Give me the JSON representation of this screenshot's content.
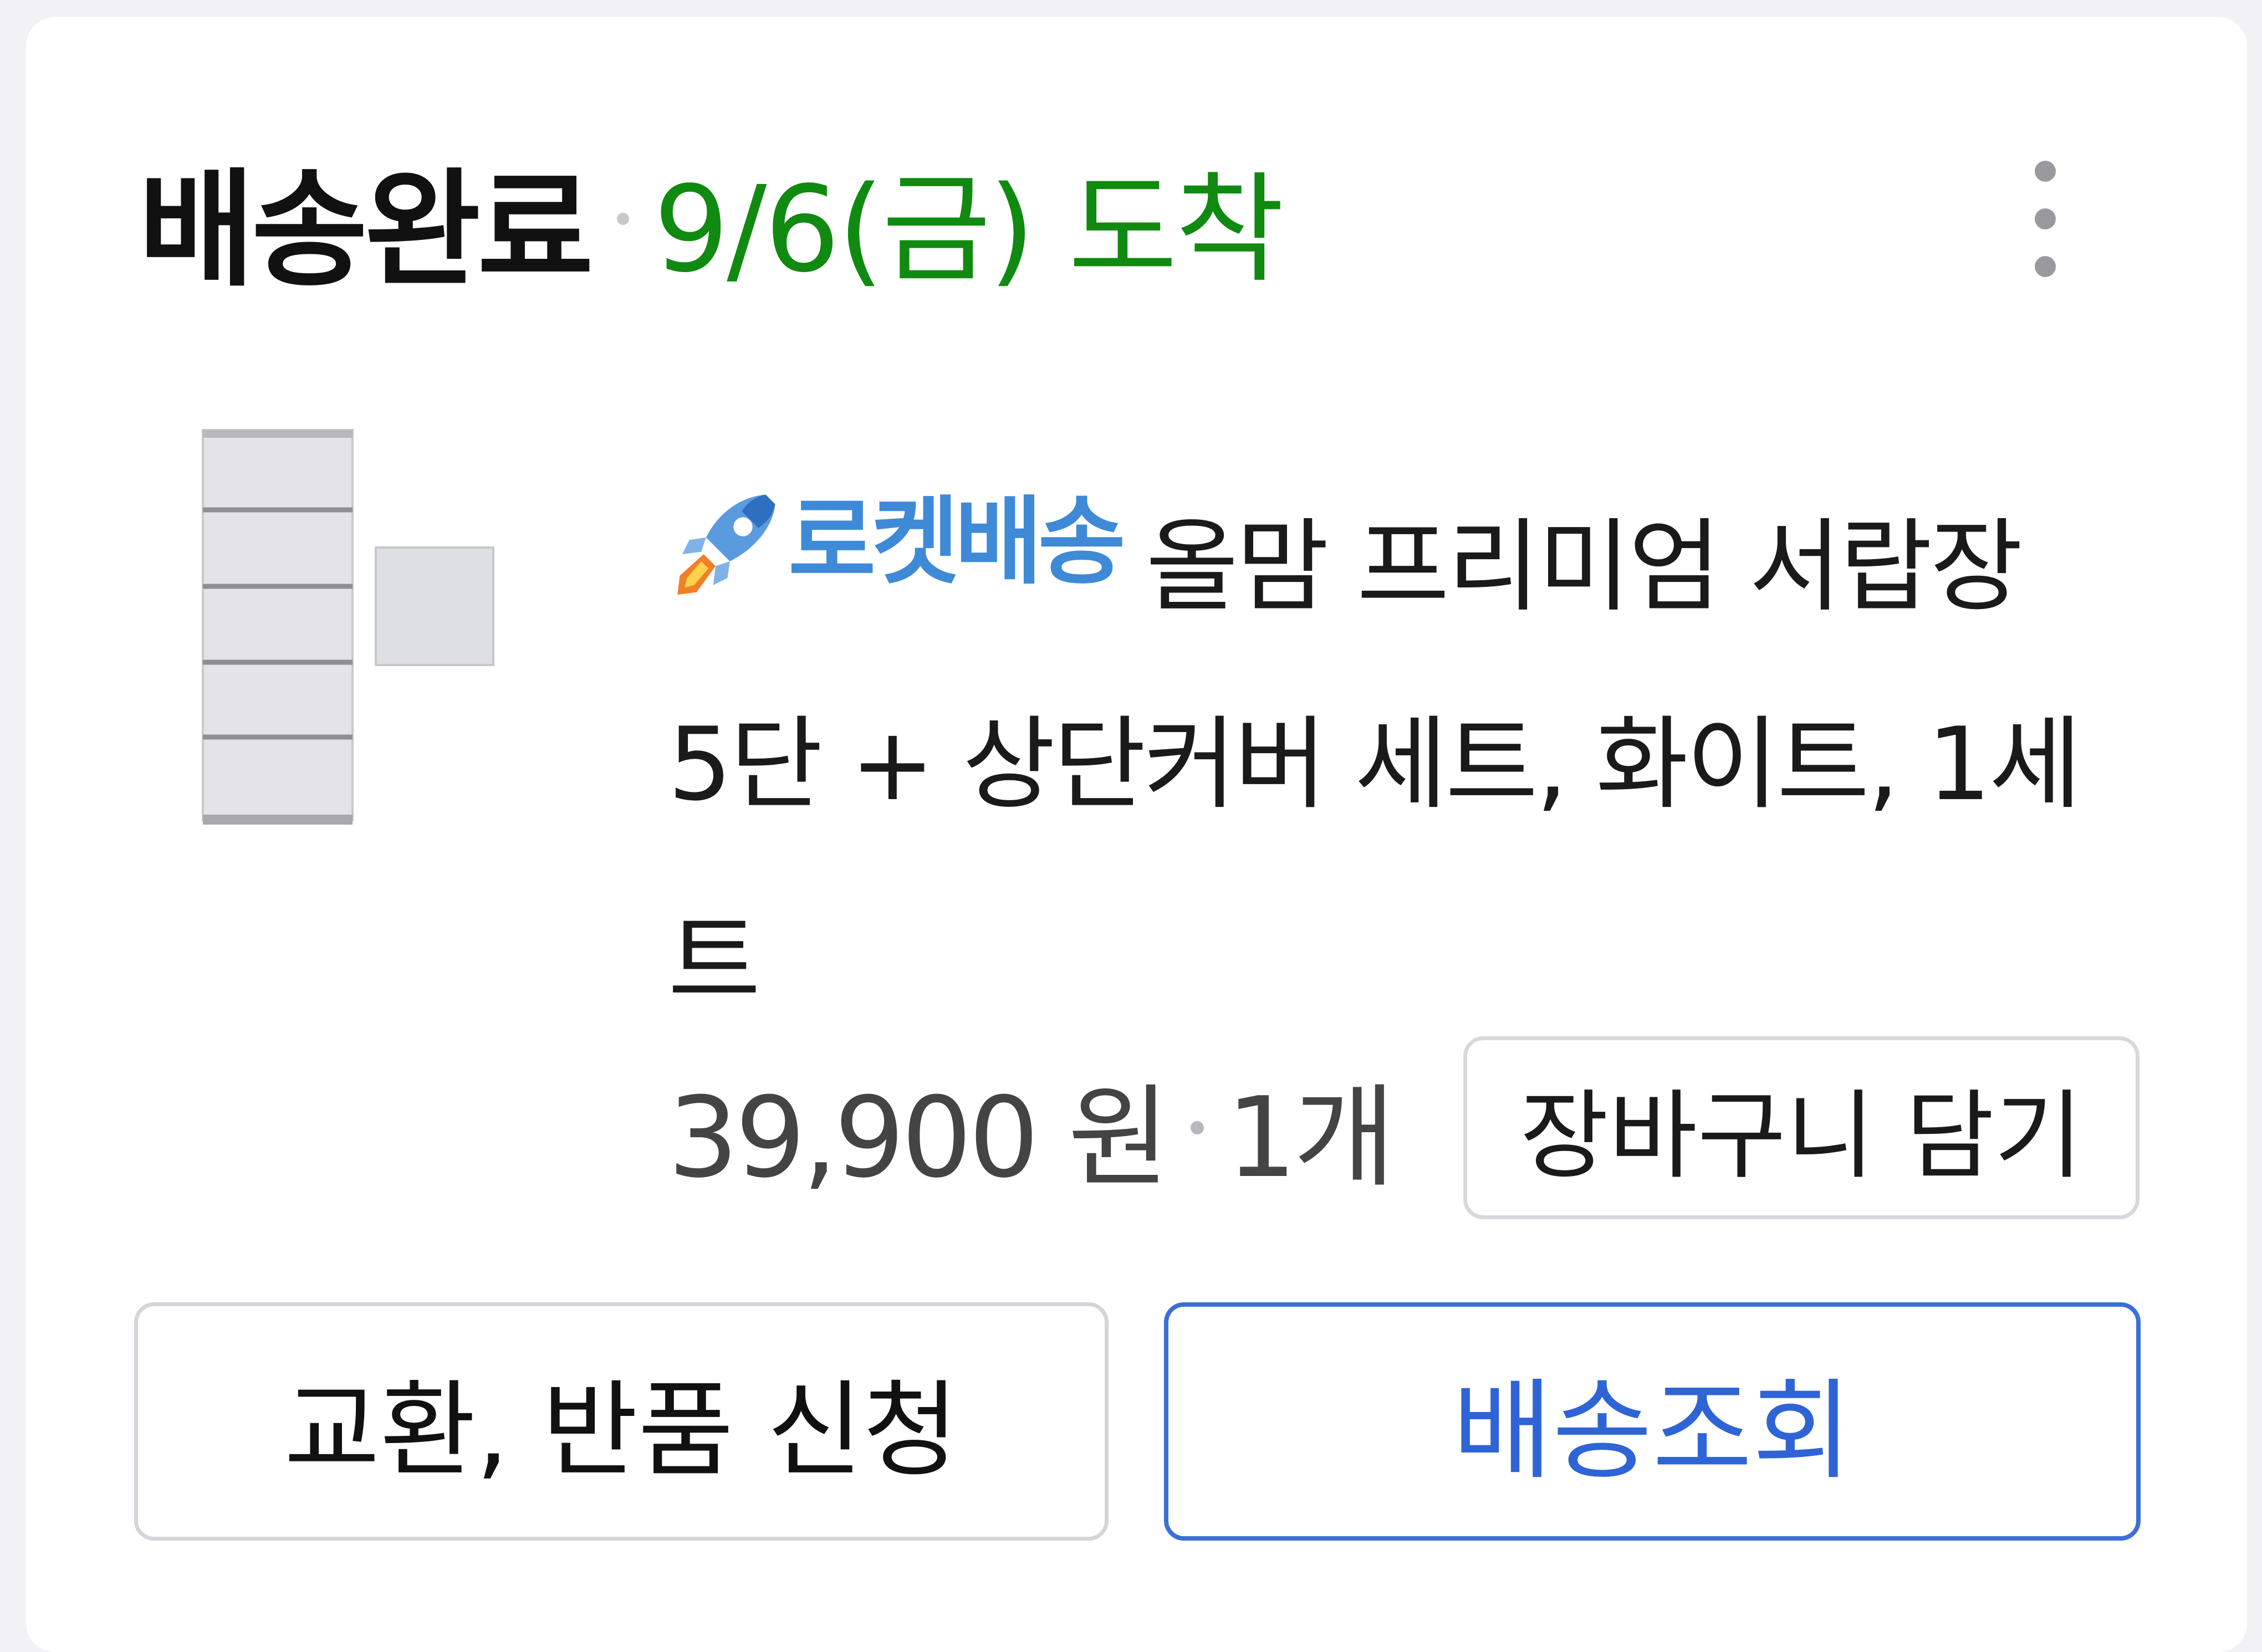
{
  "order": {
    "status": "배송완료",
    "arrival": "9/6(금) 도착"
  },
  "icons": {
    "more": "more-vertical-icon",
    "rocket": "rocket-icon"
  },
  "product": {
    "badge": "로켓배송",
    "title": "올맘 프리미엄 서랍장 5단 + 상단커버 세트, 화이트, 1세트",
    "price": "39,900 원",
    "quantity": "1개"
  },
  "actions": {
    "add_to_cart": "장바구니 담기",
    "return_exchange": "교환, 반품 신청",
    "track_delivery": "배송조회"
  },
  "colors": {
    "arrival": "#108a10",
    "rocket_badge": "#3e8ad7",
    "track_button": "#2f64d6"
  }
}
